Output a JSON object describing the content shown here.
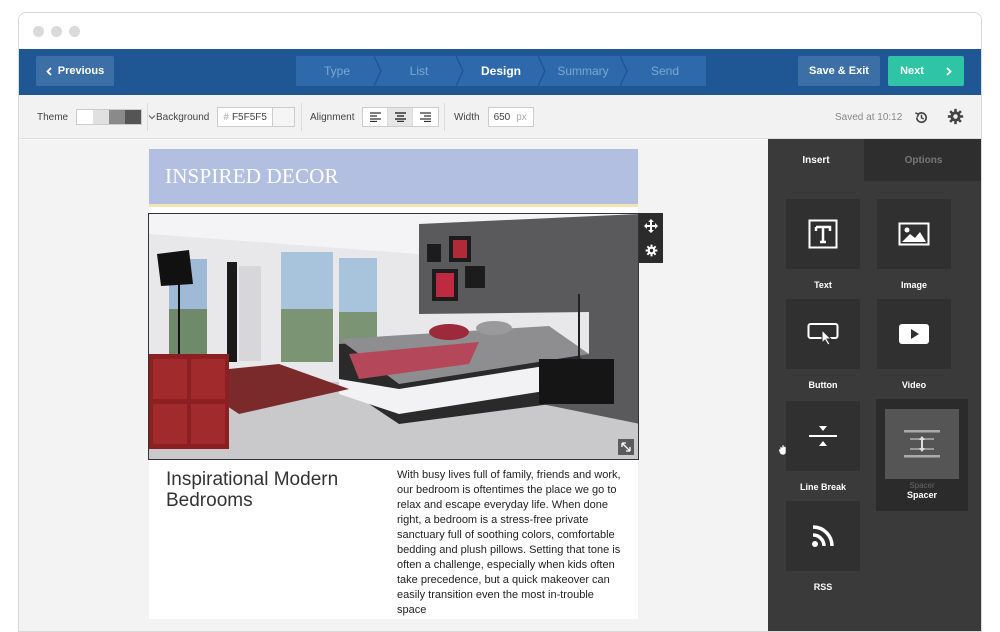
{
  "nav": {
    "previous_label": "Previous",
    "steps": [
      {
        "label": "Type"
      },
      {
        "label": "List"
      },
      {
        "label": "Design"
      },
      {
        "label": "Summary"
      },
      {
        "label": "Send"
      }
    ],
    "active_step": "Design",
    "save_exit_label": "Save & Exit",
    "next_label": "Next"
  },
  "toolbar": {
    "theme_label": "Theme",
    "theme_colors": [
      "#ffffff",
      "#e0e0e0",
      "#8a8a8a",
      "#555555"
    ],
    "background_label": "Background",
    "background_hash": "#",
    "background_value": "F5F5F5",
    "alignment_label": "Alignment",
    "width_label": "Width",
    "width_value": "650",
    "width_unit": "px",
    "saved_text": "Saved at 10:12"
  },
  "email": {
    "header_title": "INSPIRED DECOR",
    "heading": "Inspirational Modern Bedrooms",
    "body": "With busy lives full of family, friends and work, our bedroom is oftentimes the place we go to relax and escape everyday life. When done right, a bedroom is a stress-free private sanctuary full of soothing colors, comfortable bedding and plush pillows. Setting that tone is often a challenge, especially when kids often take precedence, but a quick makeover can easily transition even the most in-trouble space",
    "header_color": "#b3bfe1"
  },
  "sidebar": {
    "tabs": {
      "insert": "Insert",
      "options": "Options"
    },
    "tiles": [
      {
        "label": "Text",
        "icon": "text-icon"
      },
      {
        "label": "Image",
        "icon": "image-icon"
      },
      {
        "label": "Button",
        "icon": "button-icon"
      },
      {
        "label": "Video",
        "icon": "video-icon"
      },
      {
        "label": "Line Break",
        "icon": "line-break-icon"
      },
      {
        "label": "RSS",
        "icon": "rss-icon"
      }
    ],
    "dragging": {
      "label": "Spacer",
      "ghost": "Spacer",
      "icon": "spacer-icon"
    }
  },
  "colors": {
    "nav_bg": "#1f5795",
    "next_bg": "#2fc4a6",
    "sidebar_bg": "#3a3a3a"
  }
}
